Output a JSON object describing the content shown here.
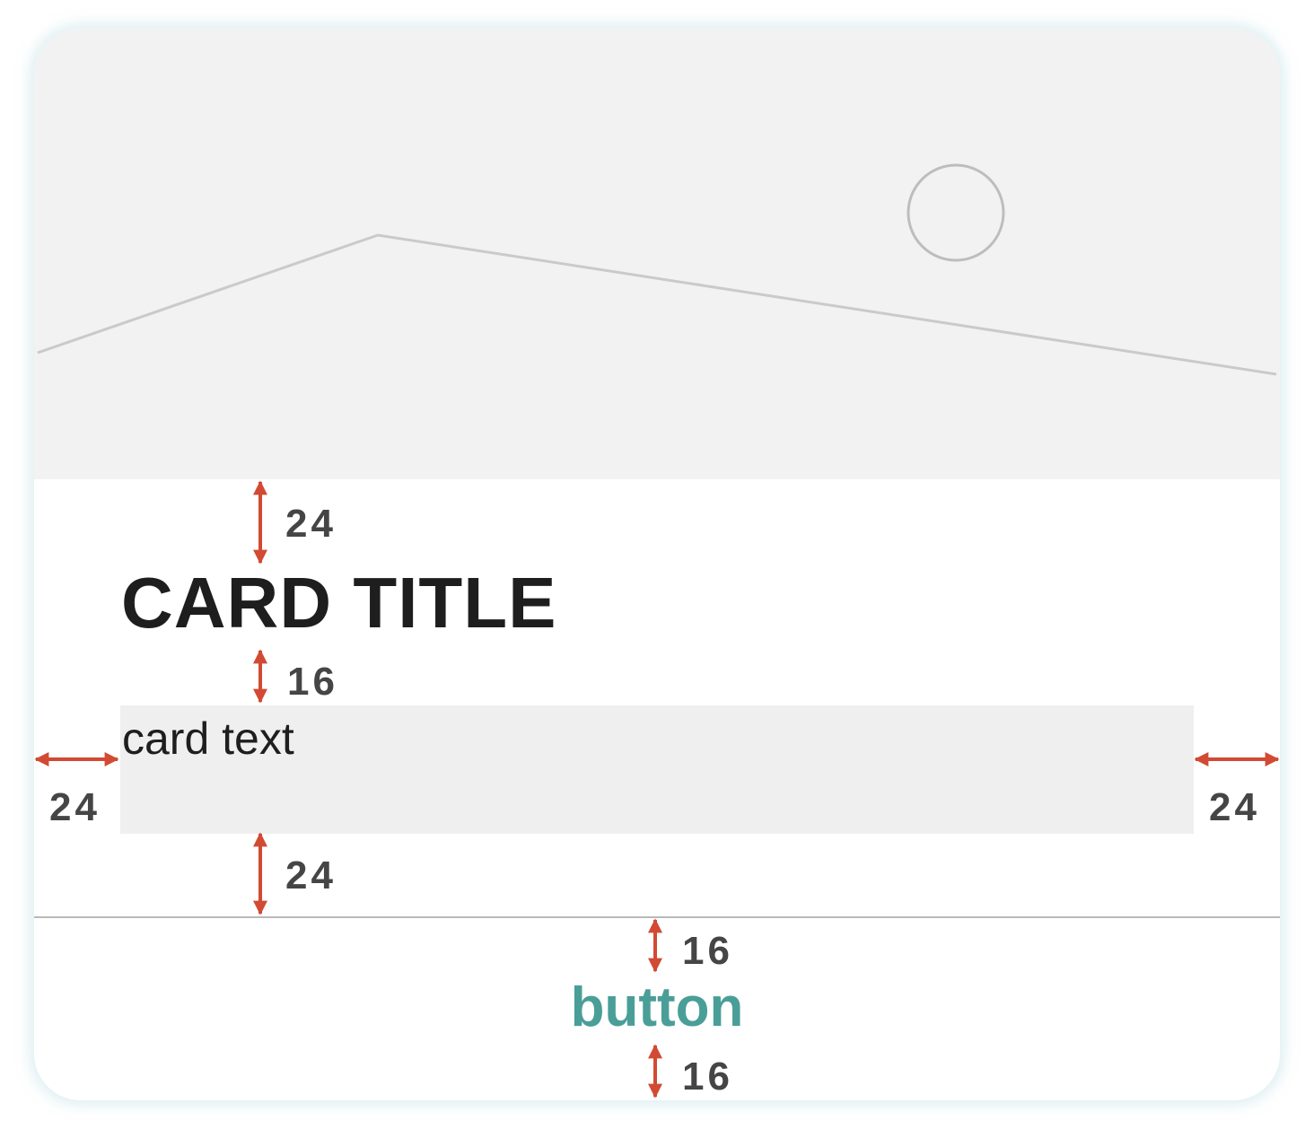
{
  "card": {
    "title": "CARD TITLE",
    "text": "card text",
    "button_label": "button"
  },
  "annotations": {
    "media_to_title": "24",
    "title_to_text": "16",
    "left_padding": "24",
    "right_padding": "24",
    "text_to_divider": "24",
    "divider_to_button": "16",
    "button_to_bottom": "16"
  },
  "colors": {
    "accent": "#4a9e98",
    "annotation_arrow": "#d24a33",
    "media_background": "#f2f2f2",
    "text_area": "#efefef"
  }
}
